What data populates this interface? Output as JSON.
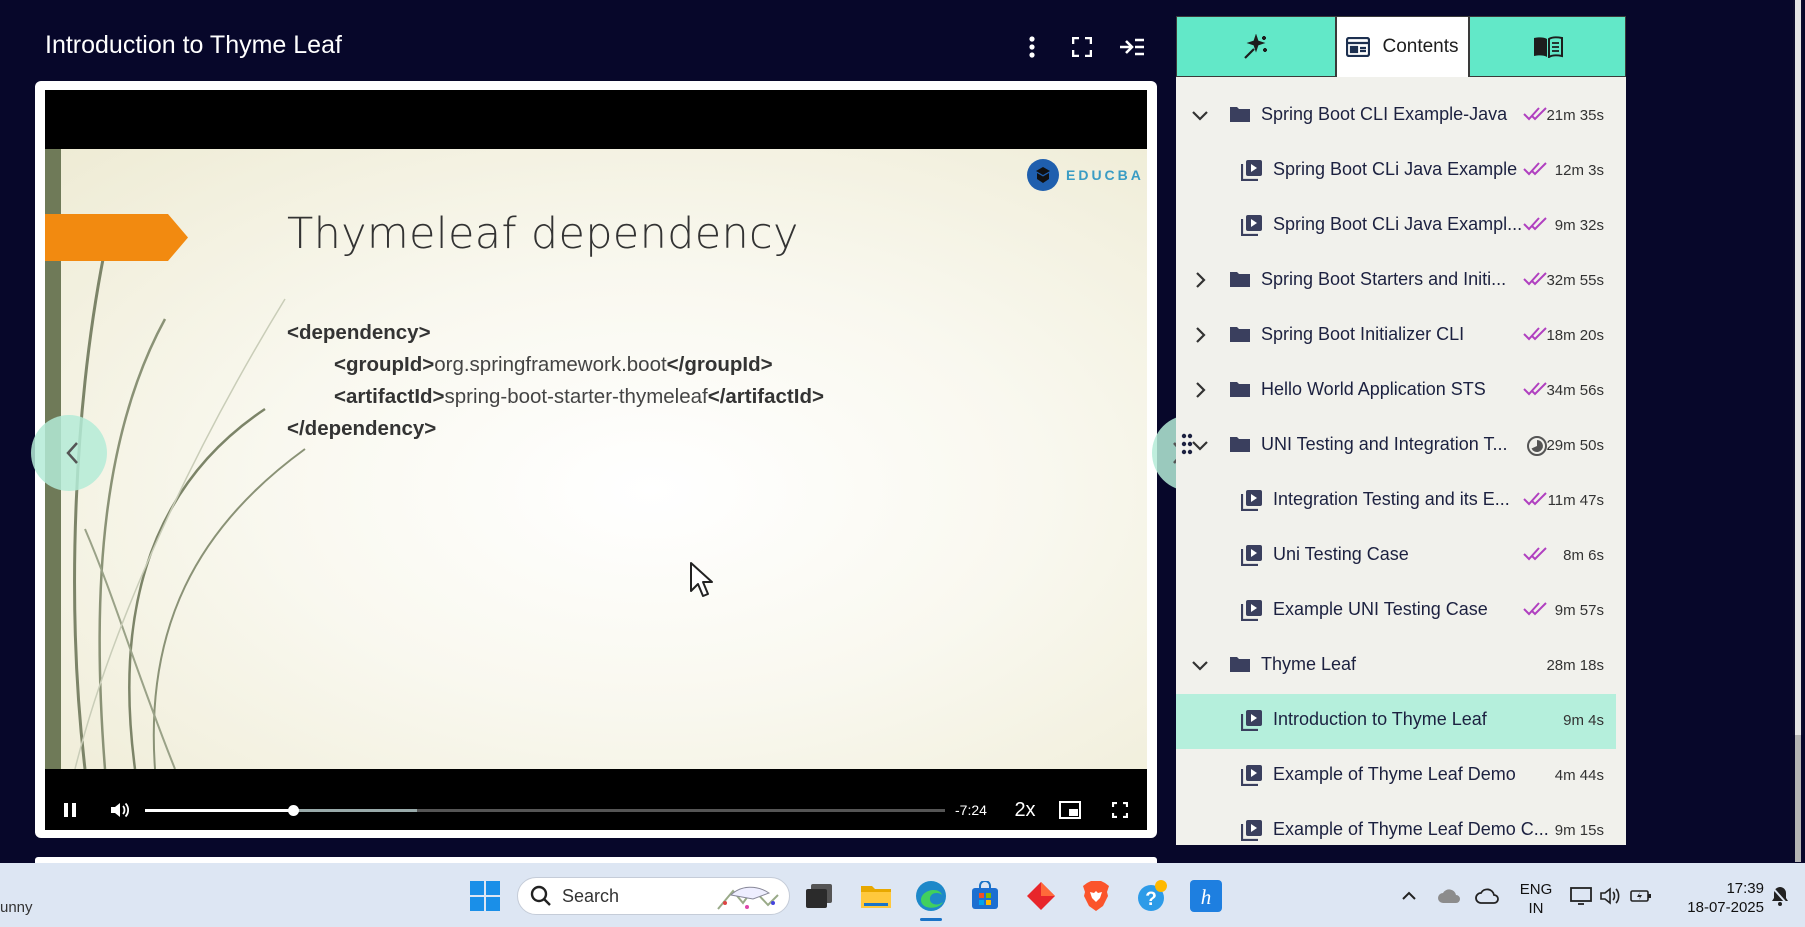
{
  "header": {
    "title": "Introduction to Thyme Leaf",
    "more_icon": "more-vertical-icon",
    "fullscreen_icon": "expand-icon",
    "collapse_icon": "collapse-sidebar-icon"
  },
  "slide": {
    "title": "Thymeleaf dependency",
    "logo_text": "EDUCBA",
    "code": {
      "line1": "<dependency>",
      "line2_open": "<groupId>",
      "line2_value": "org.springframework.boot",
      "line2_close": "</groupId>",
      "line3_open": "<artifactId>",
      "line3_value": "spring-boot-starter-thymeleaf",
      "line3_close": "</artifactId>",
      "line4": "</dependency>"
    }
  },
  "player": {
    "time_remaining": "-7:24",
    "speed": "2x",
    "progress_fraction": 0.185,
    "buffered_fraction": 0.34
  },
  "sidebar": {
    "tabs": [
      {
        "icon": "ai-sparkle-icon",
        "label": ""
      },
      {
        "icon": "contents-icon",
        "label": "Contents"
      },
      {
        "icon": "book-icon",
        "label": ""
      }
    ],
    "items": [
      {
        "type": "folder",
        "expanded": true,
        "label": "Spring Boot CLI Example-Java",
        "status": "done",
        "duration": "21m 35s"
      },
      {
        "type": "video",
        "label": "Spring Boot CLi Java Example",
        "status": "done",
        "duration": "12m 3s"
      },
      {
        "type": "video",
        "label": "Spring Boot CLi Java Exampl...",
        "status": "done",
        "duration": "9m 32s"
      },
      {
        "type": "folder",
        "expanded": false,
        "label": "Spring Boot Starters and Initi...",
        "status": "done",
        "duration": "32m 55s"
      },
      {
        "type": "folder",
        "expanded": false,
        "label": "Spring Boot Initializer CLI",
        "status": "done",
        "duration": "18m 20s"
      },
      {
        "type": "folder",
        "expanded": false,
        "label": "Hello World Application STS",
        "status": "done",
        "duration": "34m 56s"
      },
      {
        "type": "folder",
        "expanded": true,
        "label": "UNI Testing and Integration T...",
        "status": "partial",
        "duration": "29m 50s"
      },
      {
        "type": "video",
        "label": "Integration Testing and its E...",
        "status": "done",
        "duration": "11m 47s"
      },
      {
        "type": "video",
        "label": "Uni Testing Case",
        "status": "done",
        "duration": "8m 6s"
      },
      {
        "type": "video",
        "label": "Example UNI Testing Case",
        "status": "done",
        "duration": "9m 57s"
      },
      {
        "type": "folder",
        "expanded": true,
        "label": "Thyme Leaf",
        "status": "none",
        "duration": "28m 18s"
      },
      {
        "type": "video",
        "label": "Introduction to Thyme Leaf",
        "status": "none",
        "duration": "9m 4s",
        "active": true
      },
      {
        "type": "video",
        "label": "Example of Thyme Leaf Demo",
        "status": "none",
        "duration": "4m 44s"
      },
      {
        "type": "video",
        "label": "Example of Thyme Leaf Demo C...",
        "status": "none",
        "duration": "9m 15s"
      }
    ]
  },
  "taskbar": {
    "left_text": "unny",
    "search_placeholder": "Search",
    "language_line1": "ENG",
    "language_line2": "IN",
    "time": "17:39",
    "date": "18-07-2025",
    "apps": [
      "windows-start-icon",
      "task-view-icon",
      "file-explorer-icon",
      "edge-browser-icon",
      "microsoft-store-icon",
      "red-app-icon",
      "brave-browser-icon",
      "help-icon",
      "h-app-icon"
    ]
  },
  "colors": {
    "background": "#07072a",
    "accent": "#62e8c8",
    "active_row": "#b5efdc",
    "check": "#b040c0",
    "slide_arrow": "#f28a10"
  }
}
